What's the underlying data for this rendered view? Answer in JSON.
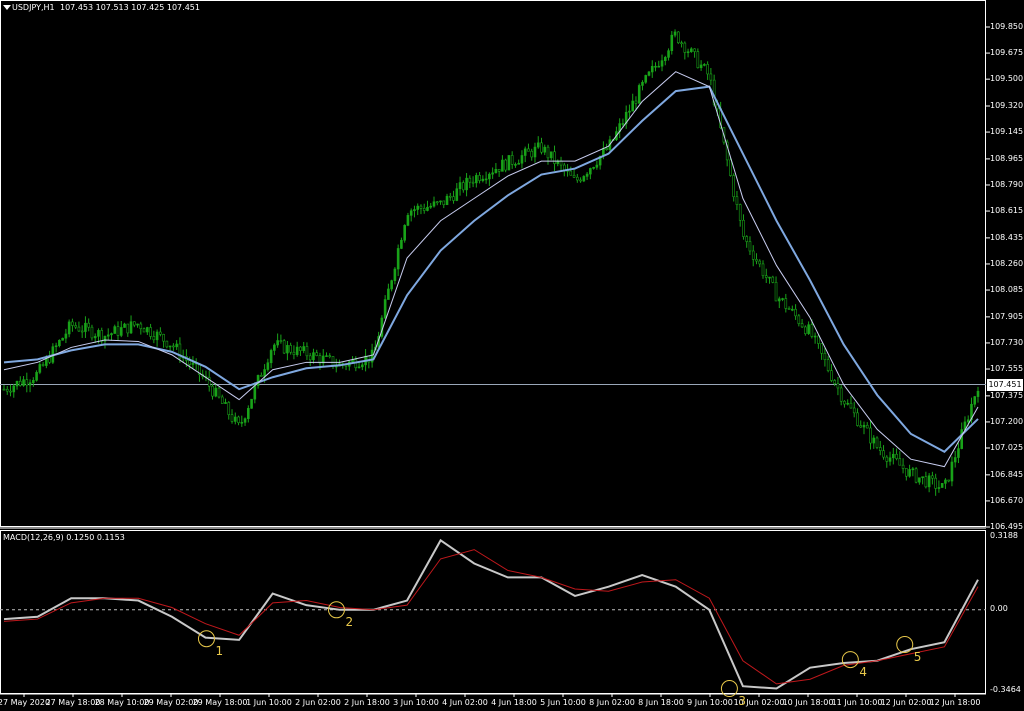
{
  "header": {
    "symbol": "USDJPY,H1",
    "ohlc": "107.453 107.513 107.425 107.451"
  },
  "current_price_label": "107.451",
  "colors": {
    "background": "#000000",
    "candle_up": "#19a319",
    "candle_down": "#19a319",
    "ma_fast": "#c8cdf0",
    "ma_slow": "#7fa8e0",
    "macd_line": "#c8c8c8",
    "signal_line": "#c0181c",
    "marker": "#e8c84a",
    "zero_line": "#bdbdbd",
    "bid_line": "#9aa7b9"
  },
  "price_axis": [
    "109.850",
    "109.675",
    "109.500",
    "109.320",
    "109.145",
    "108.965",
    "108.790",
    "108.615",
    "108.435",
    "108.260",
    "108.085",
    "107.905",
    "107.730",
    "107.555",
    "107.375",
    "107.200",
    "107.025",
    "106.845",
    "106.670",
    "106.495"
  ],
  "time_axis": [
    "27 May 2020",
    "27 May 18:00",
    "28 May 10:00",
    "29 May 02:00",
    "29 May 18:00",
    "1 Jun 10:00",
    "2 Jun 02:00",
    "2 Jun 18:00",
    "3 Jun 10:00",
    "4 Jun 02:00",
    "4 Jun 18:00",
    "5 Jun 10:00",
    "8 Jun 02:00",
    "8 Jun 18:00",
    "9 Jun 10:00",
    "10 Jun 02:00",
    "10 Jun 18:00",
    "11 Jun 10:00",
    "12 Jun 02:00",
    "12 Jun 18:00"
  ],
  "macd": {
    "title": "MACD(12,26,9) 0.1250 0.1153",
    "axis_top": "0.3188",
    "axis_zero": "0.00",
    "axis_bottom": "-0.3464"
  },
  "markers": [
    {
      "label": "1",
      "macd_value": -0.125
    },
    {
      "label": "2",
      "macd_value": 0.0
    },
    {
      "label": "3",
      "macd_value": -0.34
    },
    {
      "label": "4",
      "macd_value": -0.215
    },
    {
      "label": "5",
      "macd_value": -0.15
    }
  ],
  "chart_data": [
    {
      "type": "line",
      "title": "USDJPY,H1",
      "ylim": [
        106.495,
        109.85
      ],
      "series": [
        {
          "values": [
            107.42,
            107.52,
            107.85,
            107.78,
            107.86,
            107.72,
            107.48,
            107.16,
            107.72,
            107.66,
            107.58,
            107.64,
            108.62,
            108.66,
            108.84,
            108.94,
            109.04,
            108.81,
            109.04,
            109.45,
            109.8,
            109.52,
            108.45,
            108.05,
            107.8,
            107.35,
            107.03,
            106.85,
            106.75,
            107.45
          ]
        },
        {
          "values": [
            107.55,
            107.6,
            107.7,
            107.75,
            107.74,
            107.65,
            107.5,
            107.35,
            107.55,
            107.6,
            107.6,
            107.65,
            108.3,
            108.55,
            108.7,
            108.85,
            108.95,
            108.95,
            109.05,
            109.35,
            109.55,
            109.45,
            108.7,
            108.25,
            107.9,
            107.45,
            107.15,
            106.95,
            106.9,
            107.3
          ]
        },
        {
          "values": [
            107.6,
            107.62,
            107.68,
            107.72,
            107.72,
            107.67,
            107.57,
            107.42,
            107.5,
            107.56,
            107.58,
            107.62,
            108.05,
            108.35,
            108.55,
            108.72,
            108.86,
            108.9,
            109.0,
            109.22,
            109.42,
            109.45,
            109.0,
            108.55,
            108.15,
            107.72,
            107.38,
            107.12,
            107.0,
            107.22
          ]
        }
      ]
    },
    {
      "type": "line",
      "title": "MACD(12,26,9) 0.1250 0.1153",
      "ylim": [
        -0.3464,
        0.3188
      ],
      "series": [
        {
          "values": [
            -0.04,
            -0.03,
            0.05,
            0.05,
            0.04,
            -0.03,
            -0.12,
            -0.13,
            0.07,
            0.02,
            0.0,
            0.0,
            0.04,
            0.3,
            0.2,
            0.14,
            0.14,
            0.06,
            0.1,
            0.15,
            0.1,
            0.0,
            -0.33,
            -0.34,
            -0.25,
            -0.23,
            -0.22,
            -0.17,
            -0.14,
            0.13
          ]
        },
        {
          "values": [
            -0.05,
            -0.04,
            0.03,
            0.05,
            0.05,
            0.01,
            -0.06,
            -0.11,
            0.03,
            0.04,
            0.01,
            0.0,
            0.02,
            0.22,
            0.26,
            0.17,
            0.14,
            0.09,
            0.08,
            0.12,
            0.13,
            0.05,
            -0.22,
            -0.32,
            -0.3,
            -0.24,
            -0.22,
            -0.19,
            -0.16,
            0.1
          ]
        }
      ]
    }
  ]
}
